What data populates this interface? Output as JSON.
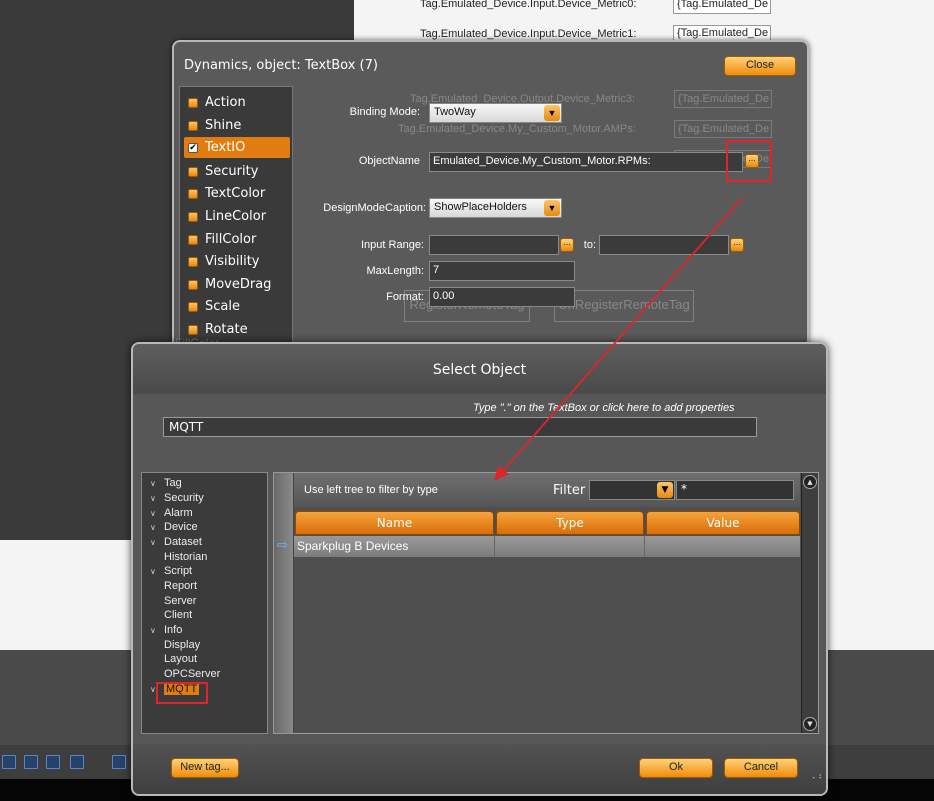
{
  "background": {
    "tag_labels": [
      "Tag.Emulated_Device.Input.Device_Metric0:",
      "Tag.Emulated_Device.Input.Device_Metric1:"
    ],
    "tag_values": [
      "{Tag.Emulated_De",
      "{Tag.Emulated_De"
    ],
    "ghost_labels": [
      "Tag.Emulated_Device.Output.Device_Metric3:",
      "Tag.Emulated_Device.My_Custom_Motor.AMPs:"
    ],
    "ghost_values": [
      "{Tag.Emulated_De",
      "{Tag.Emulated_De",
      "{Tag.Emulated_De"
    ],
    "ghost_buttons": [
      "RegisterRemoteTag",
      "UnRegisterRemoteTag"
    ],
    "ghost_list_item": "FillColor"
  },
  "dynamics": {
    "title": "Dynamics, object: TextBox (7)",
    "close_label": "Close",
    "items": [
      {
        "label": "Action",
        "selected": false
      },
      {
        "label": "Shine",
        "selected": false
      },
      {
        "label": "TextIO",
        "selected": true
      },
      {
        "label": "Security",
        "selected": false
      },
      {
        "label": "TextColor",
        "selected": false
      },
      {
        "label": "LineColor",
        "selected": false
      },
      {
        "label": "FillColor",
        "selected": false
      },
      {
        "label": "Visibility",
        "selected": false
      },
      {
        "label": "MoveDrag",
        "selected": false
      },
      {
        "label": "Scale",
        "selected": false
      },
      {
        "label": "Rotate",
        "selected": false
      }
    ],
    "binding_mode_label": "Binding Mode:",
    "binding_mode_value": "TwoWay",
    "object_name_label": "ObjectName",
    "object_name_value": "Emulated_Device.My_Custom_Motor.RPMs:",
    "design_caption_label": "DesignModeCaption:",
    "design_caption_value": "ShowPlaceHolders",
    "input_range_label": "Input Range:",
    "input_range_from": "",
    "input_range_to_label": "to:",
    "input_range_to": "",
    "maxlength_label": "MaxLength:",
    "maxlength_value": "7",
    "format_label": "Format:",
    "format_value": "0.00",
    "ellipsis": "..."
  },
  "select_object": {
    "title": "Select Object",
    "hint": "Type \".\" on the TextBox or click here to add properties",
    "search_value": "MQTT",
    "tree": [
      {
        "label": "Tag",
        "expandable": true
      },
      {
        "label": "Security",
        "expandable": true
      },
      {
        "label": "Alarm",
        "expandable": true
      },
      {
        "label": "Device",
        "expandable": true
      },
      {
        "label": "Dataset",
        "expandable": true
      },
      {
        "label": "Historian",
        "expandable": false
      },
      {
        "label": "Script",
        "expandable": true
      },
      {
        "label": "Report",
        "expandable": false
      },
      {
        "label": "Server",
        "expandable": false
      },
      {
        "label": "Client",
        "expandable": false
      },
      {
        "label": "Info",
        "expandable": true
      },
      {
        "label": "Display",
        "expandable": false
      },
      {
        "label": "Layout",
        "expandable": false
      },
      {
        "label": "OPCServer",
        "expandable": false
      },
      {
        "label": "MQTT",
        "expandable": true
      }
    ],
    "grid_caption": "Use left tree to filter by type",
    "filter_label": "Filter",
    "filter_value": "*",
    "columns": [
      "Name",
      "Type",
      "Value"
    ],
    "rows": [
      {
        "name": "Sparkplug B Devices",
        "type": "",
        "value": ""
      }
    ],
    "new_tag_label": "New tag...",
    "ok_label": "Ok",
    "cancel_label": "Cancel"
  },
  "colors": {
    "accent": "#e17d10",
    "highlight_box": "#e0242a",
    "annotation_arrow": "#e0242a"
  },
  "icons": [
    "checkbox-icon",
    "dropdown-arrow-icon",
    "ellipsis-icon",
    "row-pointer-icon",
    "scroll-up-icon",
    "scroll-down-icon",
    "resize-grip-icon",
    "chevron-down-icon"
  ]
}
